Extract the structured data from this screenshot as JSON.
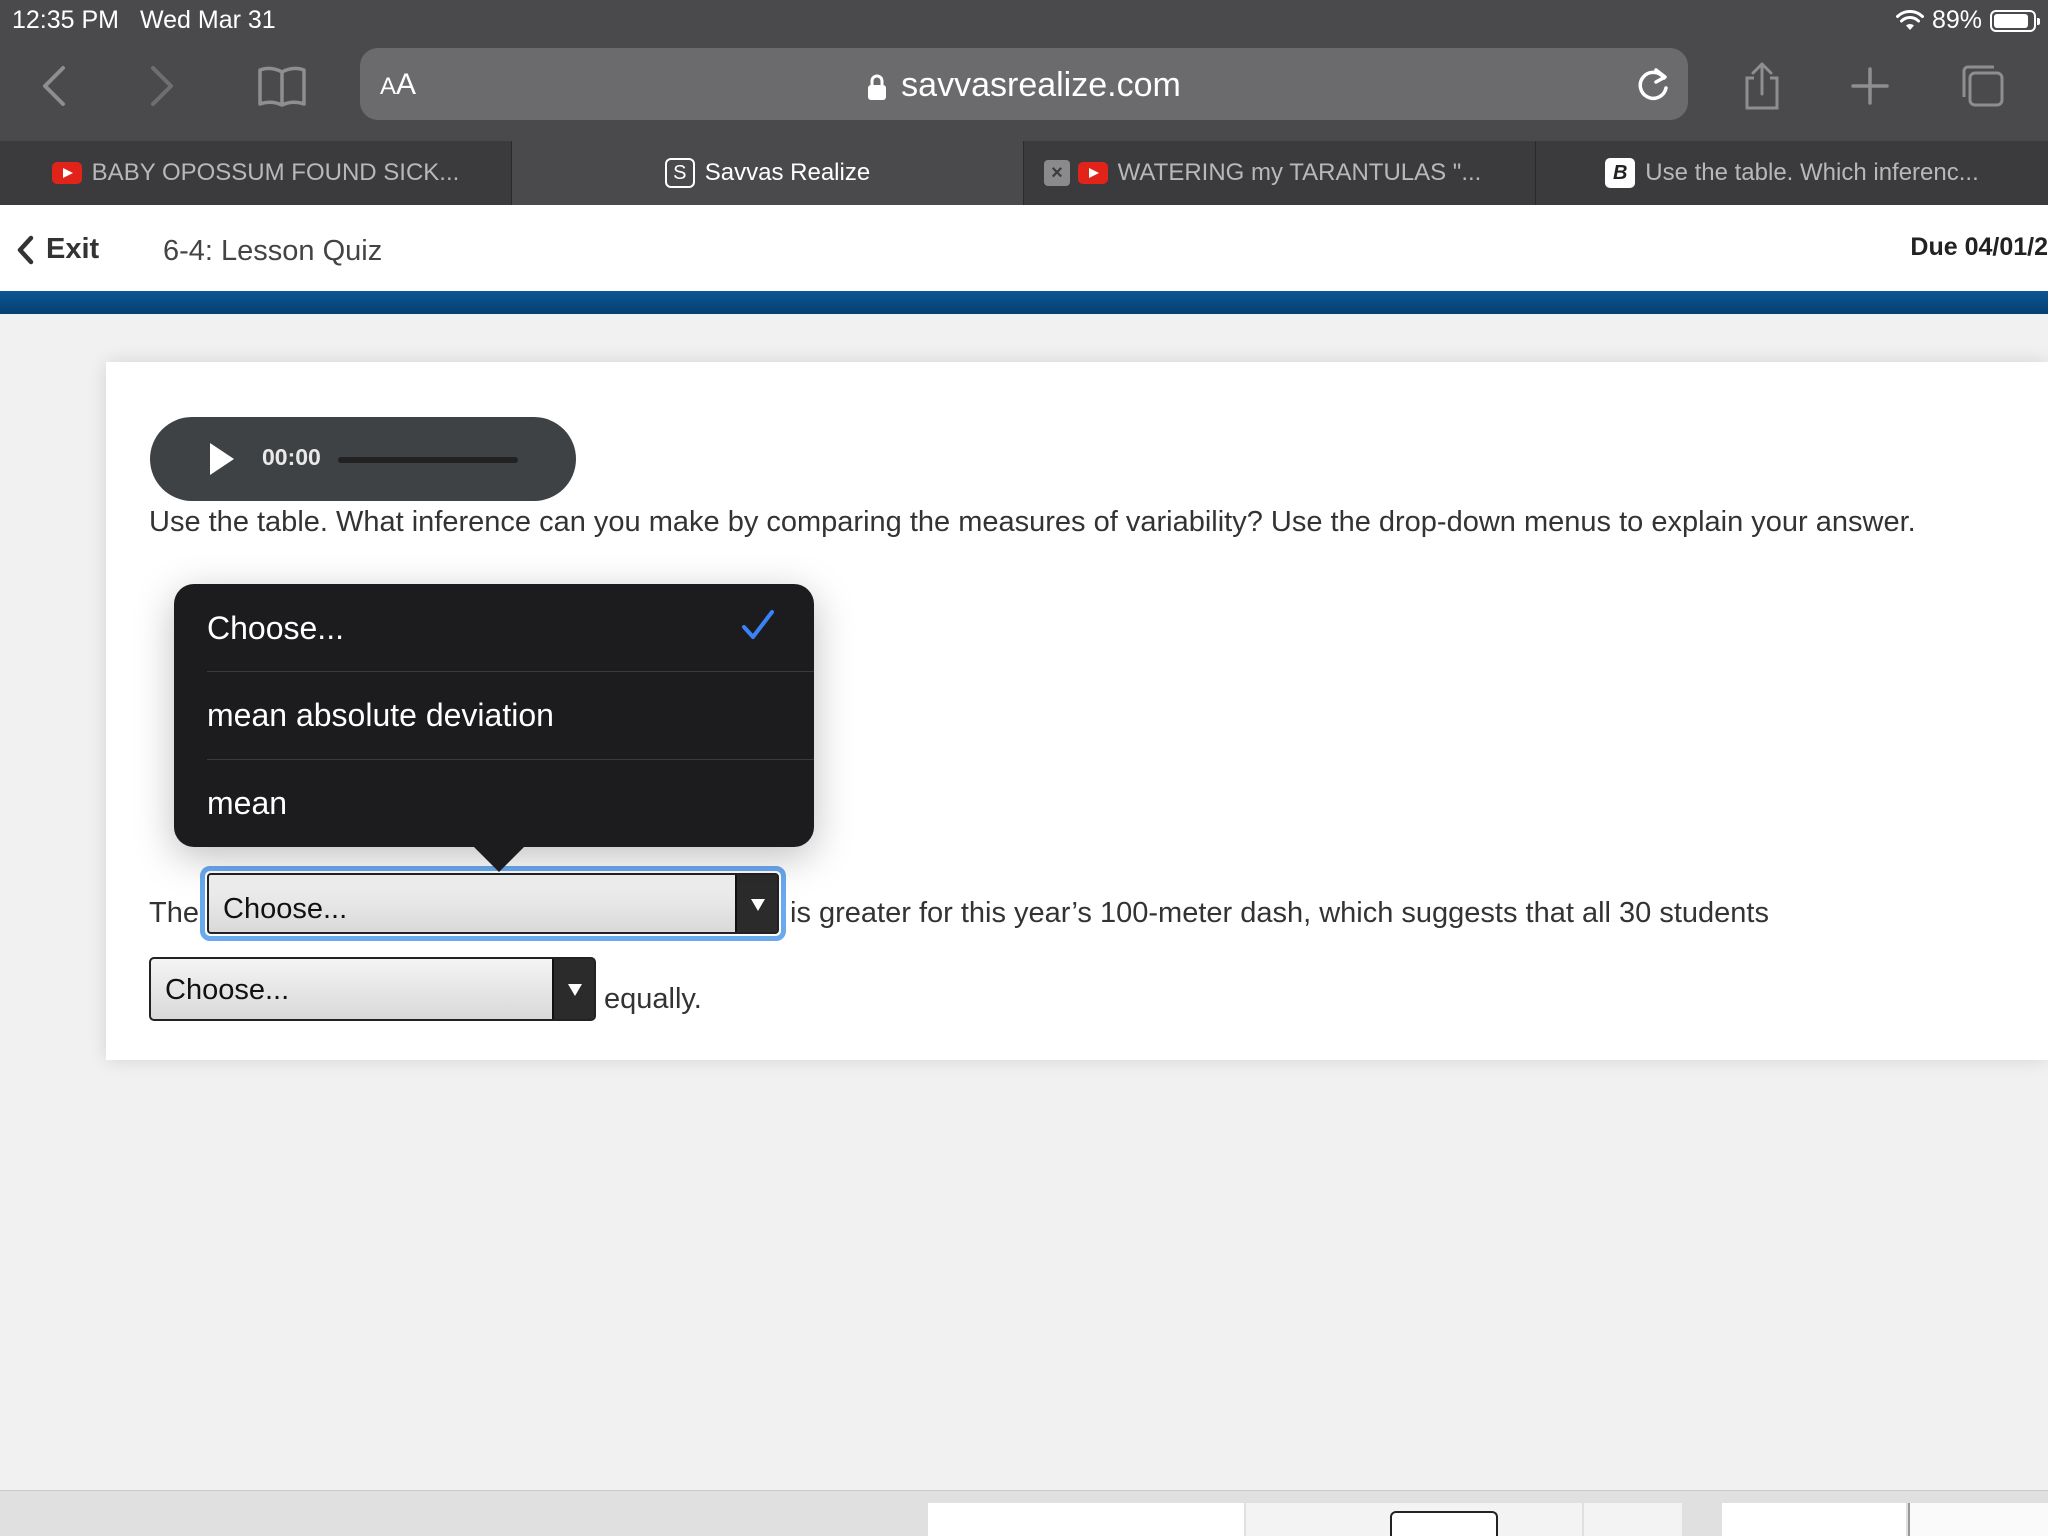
{
  "status_bar": {
    "time": "12:35 PM",
    "date": "Wed Mar 31",
    "battery": "89%",
    "battery_level": 0.89
  },
  "browser": {
    "aa_label_small": "A",
    "aa_label_large": "A",
    "url": "savvasrealize.com",
    "icons": [
      "back-icon",
      "forward-icon",
      "bookmarks-icon",
      "lock-icon",
      "reload-icon",
      "share-icon",
      "new-tab-icon",
      "tabs-icon"
    ]
  },
  "tabs": [
    {
      "label": "BABY OPOSSUM FOUND SICK...",
      "icon": "youtube-icon",
      "active": false
    },
    {
      "label": "Savvas Realize",
      "icon": "savvas-icon",
      "icon_text": "S",
      "active": true
    },
    {
      "label": "WATERING my TARANTULAS \"...",
      "icon": "youtube-icon",
      "active": false
    },
    {
      "label": "Use the table. Which inferenc...",
      "icon": "brainly-icon",
      "icon_text": "B",
      "active": false
    }
  ],
  "lesson": {
    "exit_label": "Exit",
    "title": "6-4: Lesson Quiz",
    "due": "Due 04/01/2"
  },
  "audio": {
    "time": "00:00"
  },
  "question": "Use the table. What inference can you make by comparing the measures of variability? Use the drop-down menus to explain your answer.",
  "sentence": {
    "prefix": "The",
    "select1_value": "Choose...",
    "middle": "is greater for this year’s 100-meter dash, which suggests that all 30 students",
    "select2_value": "Choose...",
    "suffix": "equally."
  },
  "dropdown": {
    "options": [
      "Choose...",
      "mean absolute deviation",
      "mean"
    ],
    "selected": "Choose..."
  },
  "colors": {
    "accent_blue": "#0b5796",
    "focus_ring": "#6aa9ee",
    "checkmark": "#3a82f7",
    "popover_bg": "#1c1c1e"
  }
}
